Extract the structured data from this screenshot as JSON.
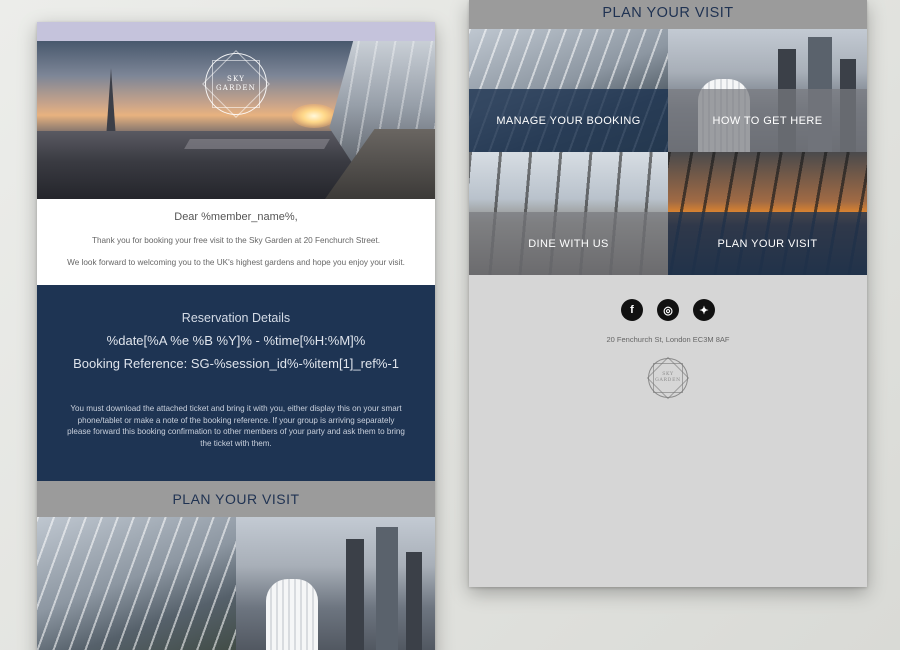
{
  "brand": {
    "logo_line1": "SKY",
    "logo_line2": "GARDEN"
  },
  "greeting": {
    "salutation": "Dear %member_name%,",
    "line1": "Thank you for booking your free visit to the Sky Garden at 20 Fenchurch Street.",
    "line2": "We look forward to welcoming you to the UK's highest gardens and hope you enjoy your visit."
  },
  "reservation": {
    "title": "Reservation Details",
    "date": "%date[%A %e %B %Y]% - %time[%H:%M]%",
    "reference": "Booking Reference: SG-%session_id%-%item[1]_ref%-1",
    "note": "You must download the attached ticket and bring it with you, either display this on your smart phone/tablet or make a note of the booking reference. If your group is arriving separately please forward this booking confirmation to other members of your party and ask them to bring the ticket with them."
  },
  "plan_section": {
    "title": "PLAN YOUR VISIT"
  },
  "tiles": [
    {
      "label": "MANAGE YOUR BOOKING"
    },
    {
      "label": "HOW TO GET HERE"
    },
    {
      "label": "DINE WITH US"
    },
    {
      "label": "PLAN YOUR VISIT"
    }
  ],
  "footer": {
    "social": [
      {
        "icon": "facebook-icon",
        "glyph": "f"
      },
      {
        "icon": "instagram-icon",
        "glyph": "◎"
      },
      {
        "icon": "twitter-icon",
        "glyph": "✦"
      }
    ],
    "address": "20 Fenchurch St, London EC3M 8AF"
  },
  "colors": {
    "navy": "#1e3453",
    "lavender": "#c5c3dc",
    "plan_bar": "#9b9b9b",
    "footer_bg": "#d6d6d6"
  }
}
